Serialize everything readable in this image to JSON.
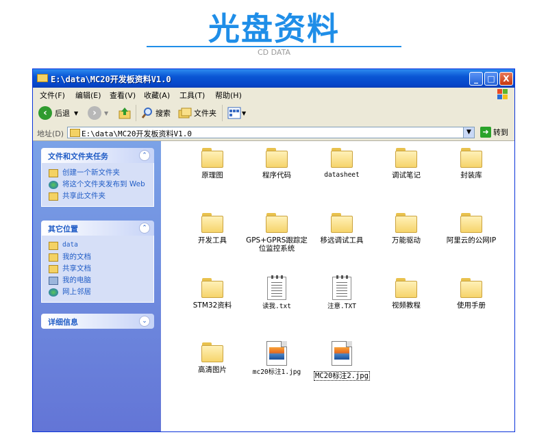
{
  "header": {
    "title": "光盘资料",
    "subtitle": "CD DATA"
  },
  "window": {
    "title": "E:\\data\\MC20开发板资料V1.0",
    "controls": {
      "minimize": "_",
      "maximize": "□",
      "close": "X"
    }
  },
  "menu": [
    "文件(F)",
    "编辑(E)",
    "查看(V)",
    "收藏(A)",
    "工具(T)",
    "帮助(H)"
  ],
  "toolbar": {
    "back": "后退",
    "search": "搜索",
    "folders": "文件夹"
  },
  "address": {
    "label": "地址(D)",
    "value": "E:\\data\\MC20开发板资料V1.0",
    "go": "转到"
  },
  "panels": {
    "tasks": {
      "title": "文件和文件夹任务",
      "items": [
        "创建一个新文件夹",
        "将这个文件夹发布到 Web",
        "共享此文件夹"
      ]
    },
    "places": {
      "title": "其它位置",
      "items": [
        "data",
        "我的文档",
        "共享文档",
        "我的电脑",
        "网上邻居"
      ]
    },
    "details": {
      "title": "详细信息"
    }
  },
  "files": [
    {
      "name": "原理图",
      "type": "folder"
    },
    {
      "name": "程序代码",
      "type": "folder"
    },
    {
      "name": "datasheet",
      "type": "folder"
    },
    {
      "name": "调试笔记",
      "type": "folder"
    },
    {
      "name": "封装库",
      "type": "folder"
    },
    {
      "name": "开发工具",
      "type": "folder"
    },
    {
      "name": "GPS+GPRS跟踪定位监控系统",
      "type": "folder"
    },
    {
      "name": "移远调试工具",
      "type": "folder"
    },
    {
      "name": "万能驱动",
      "type": "folder"
    },
    {
      "name": "阿里云的公网IP",
      "type": "folder"
    },
    {
      "name": "STM32资料",
      "type": "folder"
    },
    {
      "name": "读我.txt",
      "type": "txt"
    },
    {
      "name": "注意.TXT",
      "type": "txt"
    },
    {
      "name": "视频教程",
      "type": "folder"
    },
    {
      "name": "使用手册",
      "type": "folder"
    },
    {
      "name": "高清图片",
      "type": "folder"
    },
    {
      "name": "mc20标注1.jpg",
      "type": "image"
    },
    {
      "name": "MC20标注2.jpg",
      "type": "image",
      "selected": true
    }
  ]
}
